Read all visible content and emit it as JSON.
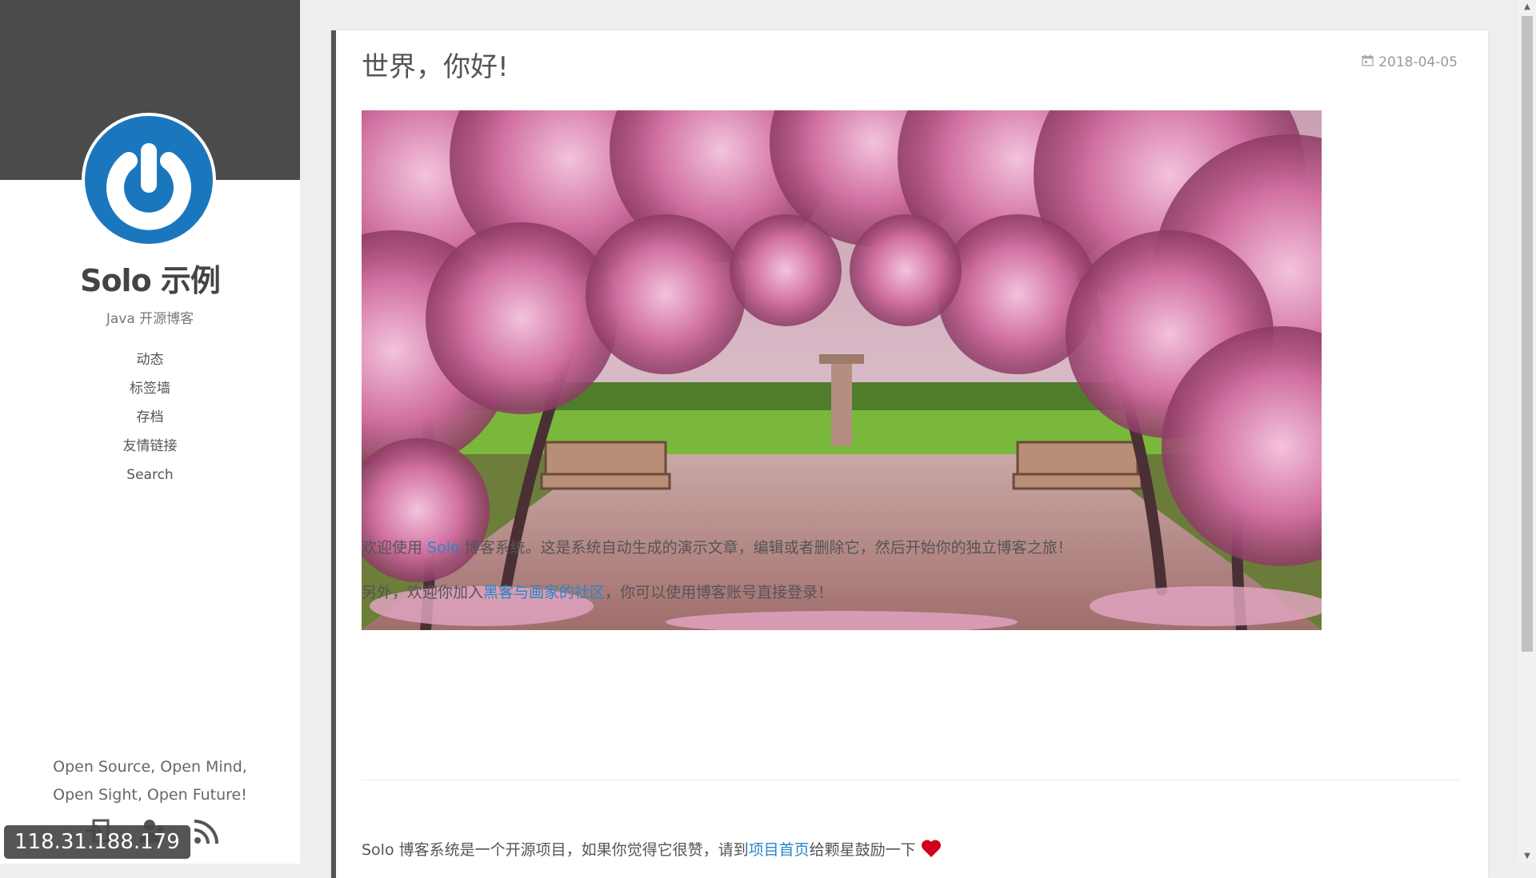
{
  "sidebar": {
    "title": "Solo 示例",
    "subtitle": "Java 开源博客",
    "nav": [
      {
        "label": "动态"
      },
      {
        "label": "标签墙"
      },
      {
        "label": "存档"
      },
      {
        "label": "友情链接"
      },
      {
        "label": "Search"
      }
    ],
    "motto_line1": "Open Source, Open Mind,",
    "motto_line2": "Open Sight, Open Future!",
    "icons": [
      "login-icon",
      "register-icon",
      "rss-icon"
    ],
    "ip_badge": "118.31.188.179",
    "logo_icon": "power-logo-icon"
  },
  "article": {
    "title": "世界，你好!",
    "date": "2018-04-05",
    "date_icon": "calendar-icon",
    "image_alt": "magnolia-garden-photo",
    "para1": {
      "prefix": "欢迎使用 ",
      "link": "Solo",
      "suffix": " 博客系统。这是系统自动生成的演示文章，编辑或者删除它，然后开始你的独立博客之旅！"
    },
    "para2": {
      "prefix": "另外，欢迎你加入",
      "link": "黑客与画家的社区",
      "suffix": "，你可以使用博客账号直接登录！"
    },
    "para3": {
      "prefix": "Solo 博客系统是一个开源项目，如果你觉得它很赞，请到",
      "link": "项目首页",
      "suffix": "给颗星鼓励一下 ",
      "icon": "heart-icon"
    }
  },
  "colors": {
    "header_dark": "#4b4b4b",
    "link": "#2a86c8",
    "logo_blue": "#1b77bd",
    "heart": "#d0021b"
  }
}
